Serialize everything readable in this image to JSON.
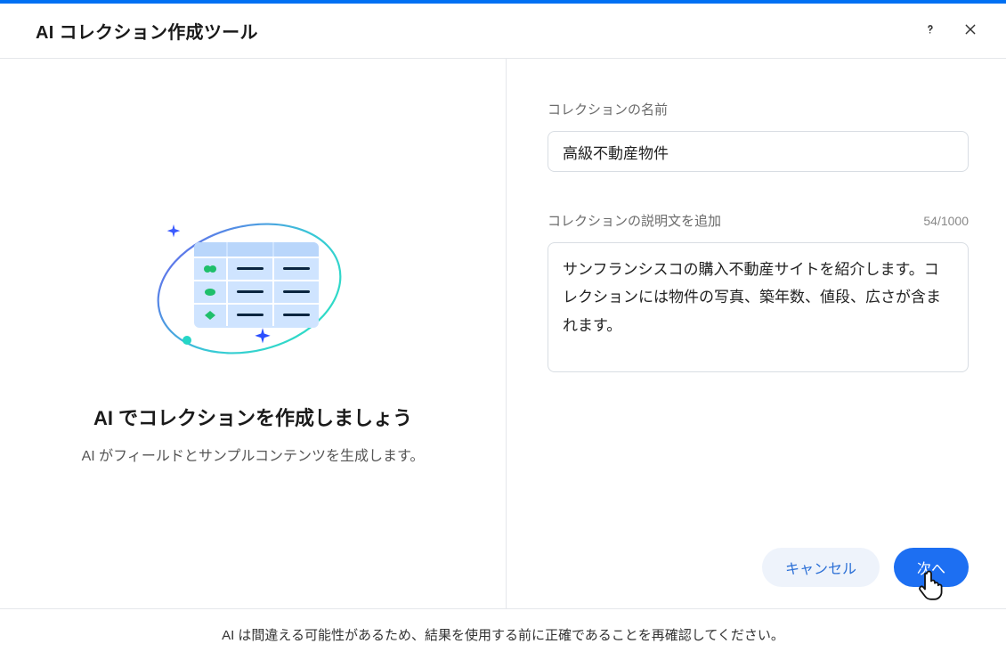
{
  "header": {
    "title": "AI コレクション作成ツール"
  },
  "left": {
    "heading": "AI でコレクションを作成しましょう",
    "subtext": "AI がフィールドとサンプルコンテンツを生成します。"
  },
  "form": {
    "name_label": "コレクションの名前",
    "name_value": "高級不動産物件",
    "desc_label": "コレクションの説明文を追加",
    "desc_value": "サンフランシスコの購入不動産サイトを紹介します。コレクションには物件の写真、築年数、値段、広さが含まれます。",
    "char_count": "54/1000"
  },
  "buttons": {
    "cancel": "キャンセル",
    "next": "次へ"
  },
  "footer": {
    "disclaimer": "AI は間違える可能性があるため、結果を使用する前に正確であることを再確認してください。"
  }
}
